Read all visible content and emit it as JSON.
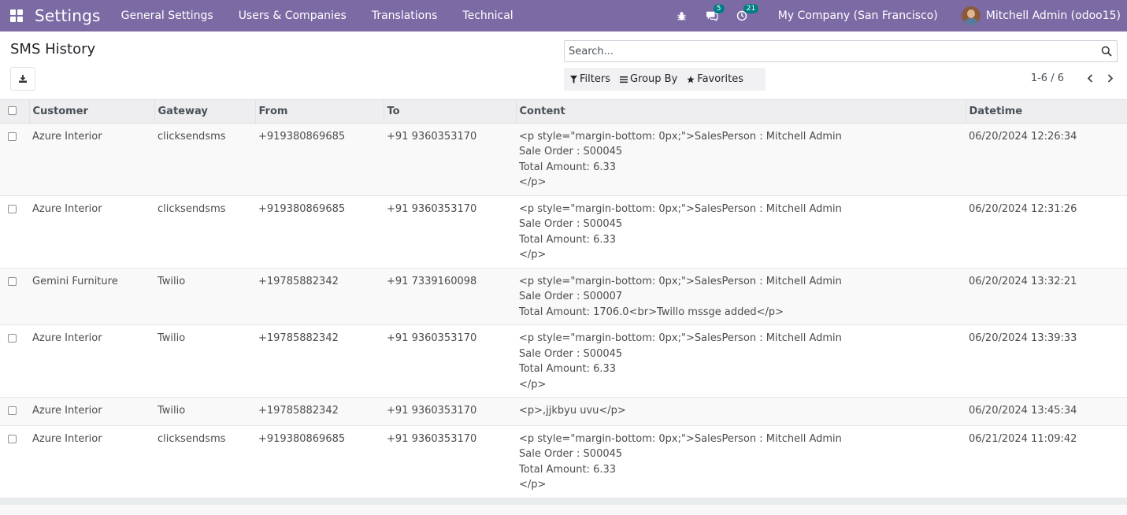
{
  "navbar": {
    "app_name": "Settings",
    "menu": [
      "General Settings",
      "Users & Companies",
      "Translations",
      "Technical"
    ],
    "messages_count": "5",
    "activities_count": "21",
    "company": "My Company (San Francisco)",
    "user": "Mitchell Admin (odoo15)"
  },
  "control_panel": {
    "title": "SMS History",
    "search_placeholder": "Search...",
    "filters_label": "Filters",
    "groupby_label": "Group By",
    "favorites_label": "Favorites",
    "pager_value": "1-6 / 6"
  },
  "table": {
    "columns": [
      "Customer",
      "Gateway",
      "From",
      "To",
      "Content",
      "Datetime"
    ],
    "rows": [
      {
        "customer": "Azure Interior",
        "gateway": "clicksendsms",
        "from": "+919380869685",
        "to": "+91 9360353170",
        "content": "<p style=\"margin-bottom: 0px;\">SalesPerson : Mitchell Admin\nSale Order : S00045\nTotal Amount: 6.33\n</p>",
        "datetime": "06/20/2024 12:26:34"
      },
      {
        "customer": "Azure Interior",
        "gateway": "clicksendsms",
        "from": "+919380869685",
        "to": "+91 9360353170",
        "content": "<p style=\"margin-bottom: 0px;\">SalesPerson : Mitchell Admin\nSale Order : S00045\nTotal Amount: 6.33\n</p>",
        "datetime": "06/20/2024 12:31:26"
      },
      {
        "customer": "Gemini Furniture",
        "gateway": "Twilio",
        "from": "+19785882342",
        "to": "+91 7339160098",
        "content": "<p style=\"margin-bottom: 0px;\">SalesPerson : Mitchell Admin\nSale Order : S00007\nTotal Amount: 1706.0<br>Twillo mssge added</p>",
        "datetime": "06/20/2024 13:32:21"
      },
      {
        "customer": "Azure Interior",
        "gateway": "Twilio",
        "from": "+19785882342",
        "to": "+91 9360353170",
        "content": "<p style=\"margin-bottom: 0px;\">SalesPerson : Mitchell Admin\nSale Order : S00045\nTotal Amount: 6.33\n</p>",
        "datetime": "06/20/2024 13:39:33"
      },
      {
        "customer": "Azure Interior",
        "gateway": "Twilio",
        "from": "+19785882342",
        "to": "+91 9360353170",
        "content": "<p>,jjkbyu uvu</p>",
        "datetime": "06/20/2024 13:45:34"
      },
      {
        "customer": "Azure Interior",
        "gateway": "clicksendsms",
        "from": "+919380869685",
        "to": "+91 9360353170",
        "content": "<p style=\"margin-bottom: 0px;\">SalesPerson : Mitchell Admin\nSale Order : S00045\nTotal Amount: 6.33\n</p>",
        "datetime": "06/21/2024 11:09:42"
      }
    ]
  },
  "colors": {
    "navbar": "#7c6aa5",
    "badge": "#017e84"
  }
}
